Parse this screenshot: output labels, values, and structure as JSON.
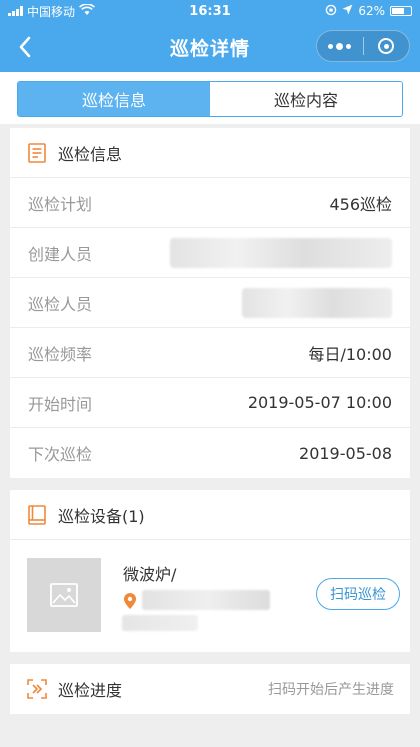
{
  "status_bar": {
    "carrier": "中国移动",
    "time": "16:31",
    "battery": "62%"
  },
  "nav": {
    "title": "巡检详情"
  },
  "tabs": [
    {
      "label": "巡检信息",
      "active": true
    },
    {
      "label": "巡检内容",
      "active": false
    }
  ],
  "info": {
    "title": "巡检信息",
    "rows": [
      {
        "label": "巡检计划",
        "value": "456巡检"
      },
      {
        "label": "创建人员",
        "value": ""
      },
      {
        "label": "巡检人员",
        "value": ""
      },
      {
        "label": "巡检频率",
        "value": "每日/10:00"
      },
      {
        "label": "开始时间",
        "value": "2019-05-07 10:00"
      },
      {
        "label": "下次巡检",
        "value": "2019-05-08"
      }
    ]
  },
  "devices": {
    "title": "巡检设备(1)",
    "items": [
      {
        "name": "微波炉/",
        "button": "扫码巡检"
      }
    ]
  },
  "progress": {
    "title": "巡检进度",
    "hint": "扫码开始后产生进度"
  },
  "colors": {
    "primary": "#4aa8ec",
    "icon_orange": "#f0883a"
  }
}
